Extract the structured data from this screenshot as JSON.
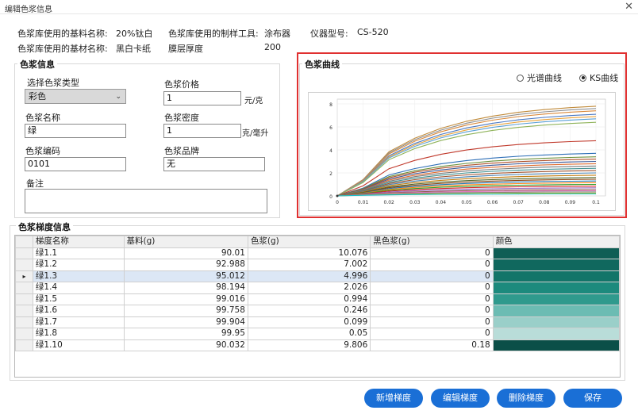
{
  "window": {
    "title": "编辑色浆信息",
    "close_glyph": "✕"
  },
  "header": {
    "base_name_label": "色浆库使用的基料名称:",
    "base_name_value": "20%钛白",
    "tool_label": "色浆库使用的制样工具:",
    "tool_value": "涂布器",
    "instrument_label": "仪器型号:",
    "instrument_value": "CS-520",
    "substrate_label": "色浆库使用的基材名称:",
    "substrate_value": "黑白卡纸",
    "thickness_label": "膜层厚度",
    "thickness_value": "200"
  },
  "paste_info": {
    "title": "色浆信息",
    "type_label": "选择色浆类型",
    "type_value": "彩色",
    "price_label": "色浆价格",
    "price_value": "1",
    "price_unit": "元/克",
    "name_label": "色浆名称",
    "name_value": "绿",
    "density_label": "色浆密度",
    "density_value": "1",
    "density_unit": "克/毫升",
    "code_label": "色浆编码",
    "code_value": "0101",
    "brand_label": "色浆品牌",
    "brand_value": "无",
    "remark_label": "备注",
    "remark_value": ""
  },
  "curve": {
    "title": "色浆曲线",
    "radio_spectral": "光谱曲线",
    "radio_ks": "KS曲线",
    "selected": "ks"
  },
  "chart_data": {
    "type": "line",
    "title": "",
    "xlabel": "",
    "ylabel": "",
    "x": [
      0,
      0.01,
      0.02,
      0.03,
      0.04,
      0.05,
      0.06,
      0.07,
      0.08,
      0.09,
      0.1
    ],
    "x_tick_labels": [
      "0",
      "0.01",
      "0.02",
      "0.03",
      "0.04",
      "0.05",
      "0.06",
      "0.07",
      "0.08",
      "0.09",
      "0.1"
    ],
    "y_tick_labels": [
      "0",
      "2",
      "4",
      "6",
      "8"
    ],
    "xlim": [
      0,
      0.1
    ],
    "ylim": [
      0,
      8
    ],
    "grid": true,
    "series_end_values": [
      7.8,
      7.6,
      7.4,
      7.1,
      6.9,
      6.7,
      6.4,
      4.8,
      3.7,
      3.4,
      3.2,
      3.0,
      2.8,
      2.6,
      2.4,
      2.2,
      2.0,
      1.8,
      1.6,
      1.45,
      1.3,
      1.15,
      1.0,
      0.85,
      0.7,
      0.55,
      0.45,
      0.35,
      0.25,
      0.18
    ],
    "series_colors": [
      "#c08a3a",
      "#8f8f8f",
      "#d9893b",
      "#4a78c2",
      "#e8a33d",
      "#5aa0d6",
      "#8fb35a",
      "#c0392b",
      "#2e6fb7",
      "#6a8f3a",
      "#b0502a",
      "#3b5998",
      "#e06c2e",
      "#7a7a7a",
      "#3d8f8f",
      "#a0522d",
      "#4682b4",
      "#c27c0e",
      "#556b2f",
      "#8b4513",
      "#1f77b4",
      "#ff7f0e",
      "#2ca02c",
      "#d62728",
      "#9467bd",
      "#8c564b",
      "#e377c2",
      "#7f7f7f",
      "#bcbd22",
      "#17becf"
    ],
    "series_shape": "concave_saturating"
  },
  "gradient": {
    "title": "色浆梯度信息",
    "columns": [
      "梯度名称",
      "基料(g)",
      "色浆(g)",
      "黑色浆(g)",
      "颜色"
    ],
    "selected_index": 2,
    "row_marker": "▸",
    "rows": [
      {
        "name": "绿1.1",
        "base": "90.01",
        "paste": "10.076",
        "black": "0",
        "color": "#0f5e55"
      },
      {
        "name": "绿1.2",
        "base": "92.988",
        "paste": "7.002",
        "black": "0",
        "color": "#10685e"
      },
      {
        "name": "绿1.3",
        "base": "95.012",
        "paste": "4.996",
        "black": "0",
        "color": "#127569"
      },
      {
        "name": "绿1.4",
        "base": "98.194",
        "paste": "2.026",
        "black": "0",
        "color": "#1c8a7d"
      },
      {
        "name": "绿1.5",
        "base": "99.016",
        "paste": "0.994",
        "black": "0",
        "color": "#2f9a8d"
      },
      {
        "name": "绿1.6",
        "base": "99.758",
        "paste": "0.246",
        "black": "0",
        "color": "#6cbcb3"
      },
      {
        "name": "绿1.7",
        "base": "99.904",
        "paste": "0.099",
        "black": "0",
        "color": "#9acfc9"
      },
      {
        "name": "绿1.8",
        "base": "99.95",
        "paste": "0.05",
        "black": "0",
        "color": "#b9ddd9"
      },
      {
        "name": "绿1.10",
        "base": "90.032",
        "paste": "9.806",
        "black": "0.18",
        "color": "#0b4f48"
      }
    ]
  },
  "buttons": {
    "add": "新增梯度",
    "edit": "编辑梯度",
    "delete": "删除梯度",
    "save": "保存"
  },
  "colors": {
    "accent": "#1a6fd6",
    "highlight_border": "#e03030"
  }
}
